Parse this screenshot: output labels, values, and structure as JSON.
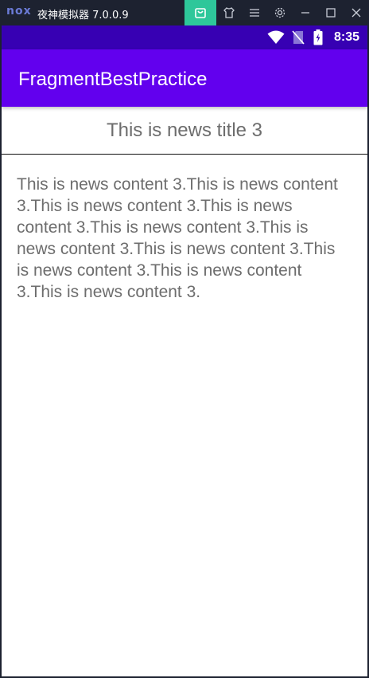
{
  "emulator": {
    "logo": "nox",
    "title": "夜神模拟器 7.0.0.9",
    "buttons": [
      "shop-icon",
      "shirt-icon",
      "menu-icon",
      "settings-icon",
      "minimize-icon",
      "maximize-icon",
      "close-icon"
    ]
  },
  "status_bar": {
    "time": "8:35",
    "icons": [
      "wifi-icon",
      "no-sim-icon",
      "battery-charging-icon"
    ]
  },
  "app_bar": {
    "title": "FragmentBestPractice"
  },
  "news": {
    "title": "This is news title 3",
    "content": "This is news content 3.This is news content 3.This is news content 3.This is news content 3.This is news content 3.This is news content 3.This is news content 3.This is news content 3.This is news content 3.This is news content 3."
  },
  "colors": {
    "status_bar": "#3700b3",
    "app_bar": "#6200ee",
    "emulator_bar": "#1d2230",
    "active_button": "#2ec79a",
    "text_gray": "#6d6d6d"
  }
}
